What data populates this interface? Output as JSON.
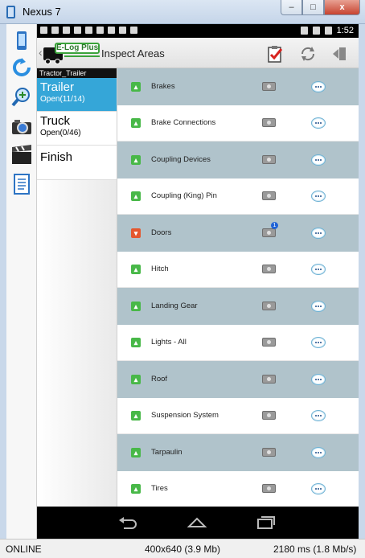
{
  "window": {
    "title": "Nexus 7",
    "controls": [
      "–",
      "□",
      "x"
    ]
  },
  "tools": [
    "phone-icon",
    "rotate-icon",
    "zoom-icon",
    "camera-icon",
    "video-icon",
    "document-icon"
  ],
  "statusbar": {
    "time": "1:52"
  },
  "actionbar": {
    "logo_text": "E-Log Plus",
    "title": "Inspect Areas",
    "actions": [
      "clipboard-check-icon",
      "refresh-icon",
      "logout-icon"
    ]
  },
  "leftpane": {
    "header": "Tractor_Trailer",
    "items": [
      {
        "name": "Trailer",
        "status": "Open(11/14)"
      },
      {
        "name": "Truck",
        "status": "Open(0/46)"
      },
      {
        "name": "Finish",
        "status": ""
      }
    ]
  },
  "list": {
    "rows": [
      {
        "label": "Brakes",
        "status": "ok"
      },
      {
        "label": "Brake Connections",
        "status": "ok"
      },
      {
        "label": "Coupling Devices",
        "status": "ok"
      },
      {
        "label": "Coupling (King) Pin",
        "status": "ok"
      },
      {
        "label": "Doors",
        "status": "defect",
        "photo_count": "1"
      },
      {
        "label": "Hitch",
        "status": "ok"
      },
      {
        "label": "Landing Gear",
        "status": "ok"
      },
      {
        "label": "Lights - All",
        "status": "ok"
      },
      {
        "label": "Roof",
        "status": "ok"
      },
      {
        "label": "Suspension System",
        "status": "ok"
      },
      {
        "label": "Tarpaulin",
        "status": "ok"
      },
      {
        "label": "Tires",
        "status": "ok"
      }
    ]
  },
  "winstatus": {
    "left": "ONLINE",
    "center": "400x640 (3.9 Mb)",
    "right": "2180 ms (1.8 Mb/s)"
  },
  "colors": {
    "selected": "#35a6d8",
    "row_alt": "#b0c3cb",
    "ok": "#48b848",
    "defect": "#e4572e"
  }
}
